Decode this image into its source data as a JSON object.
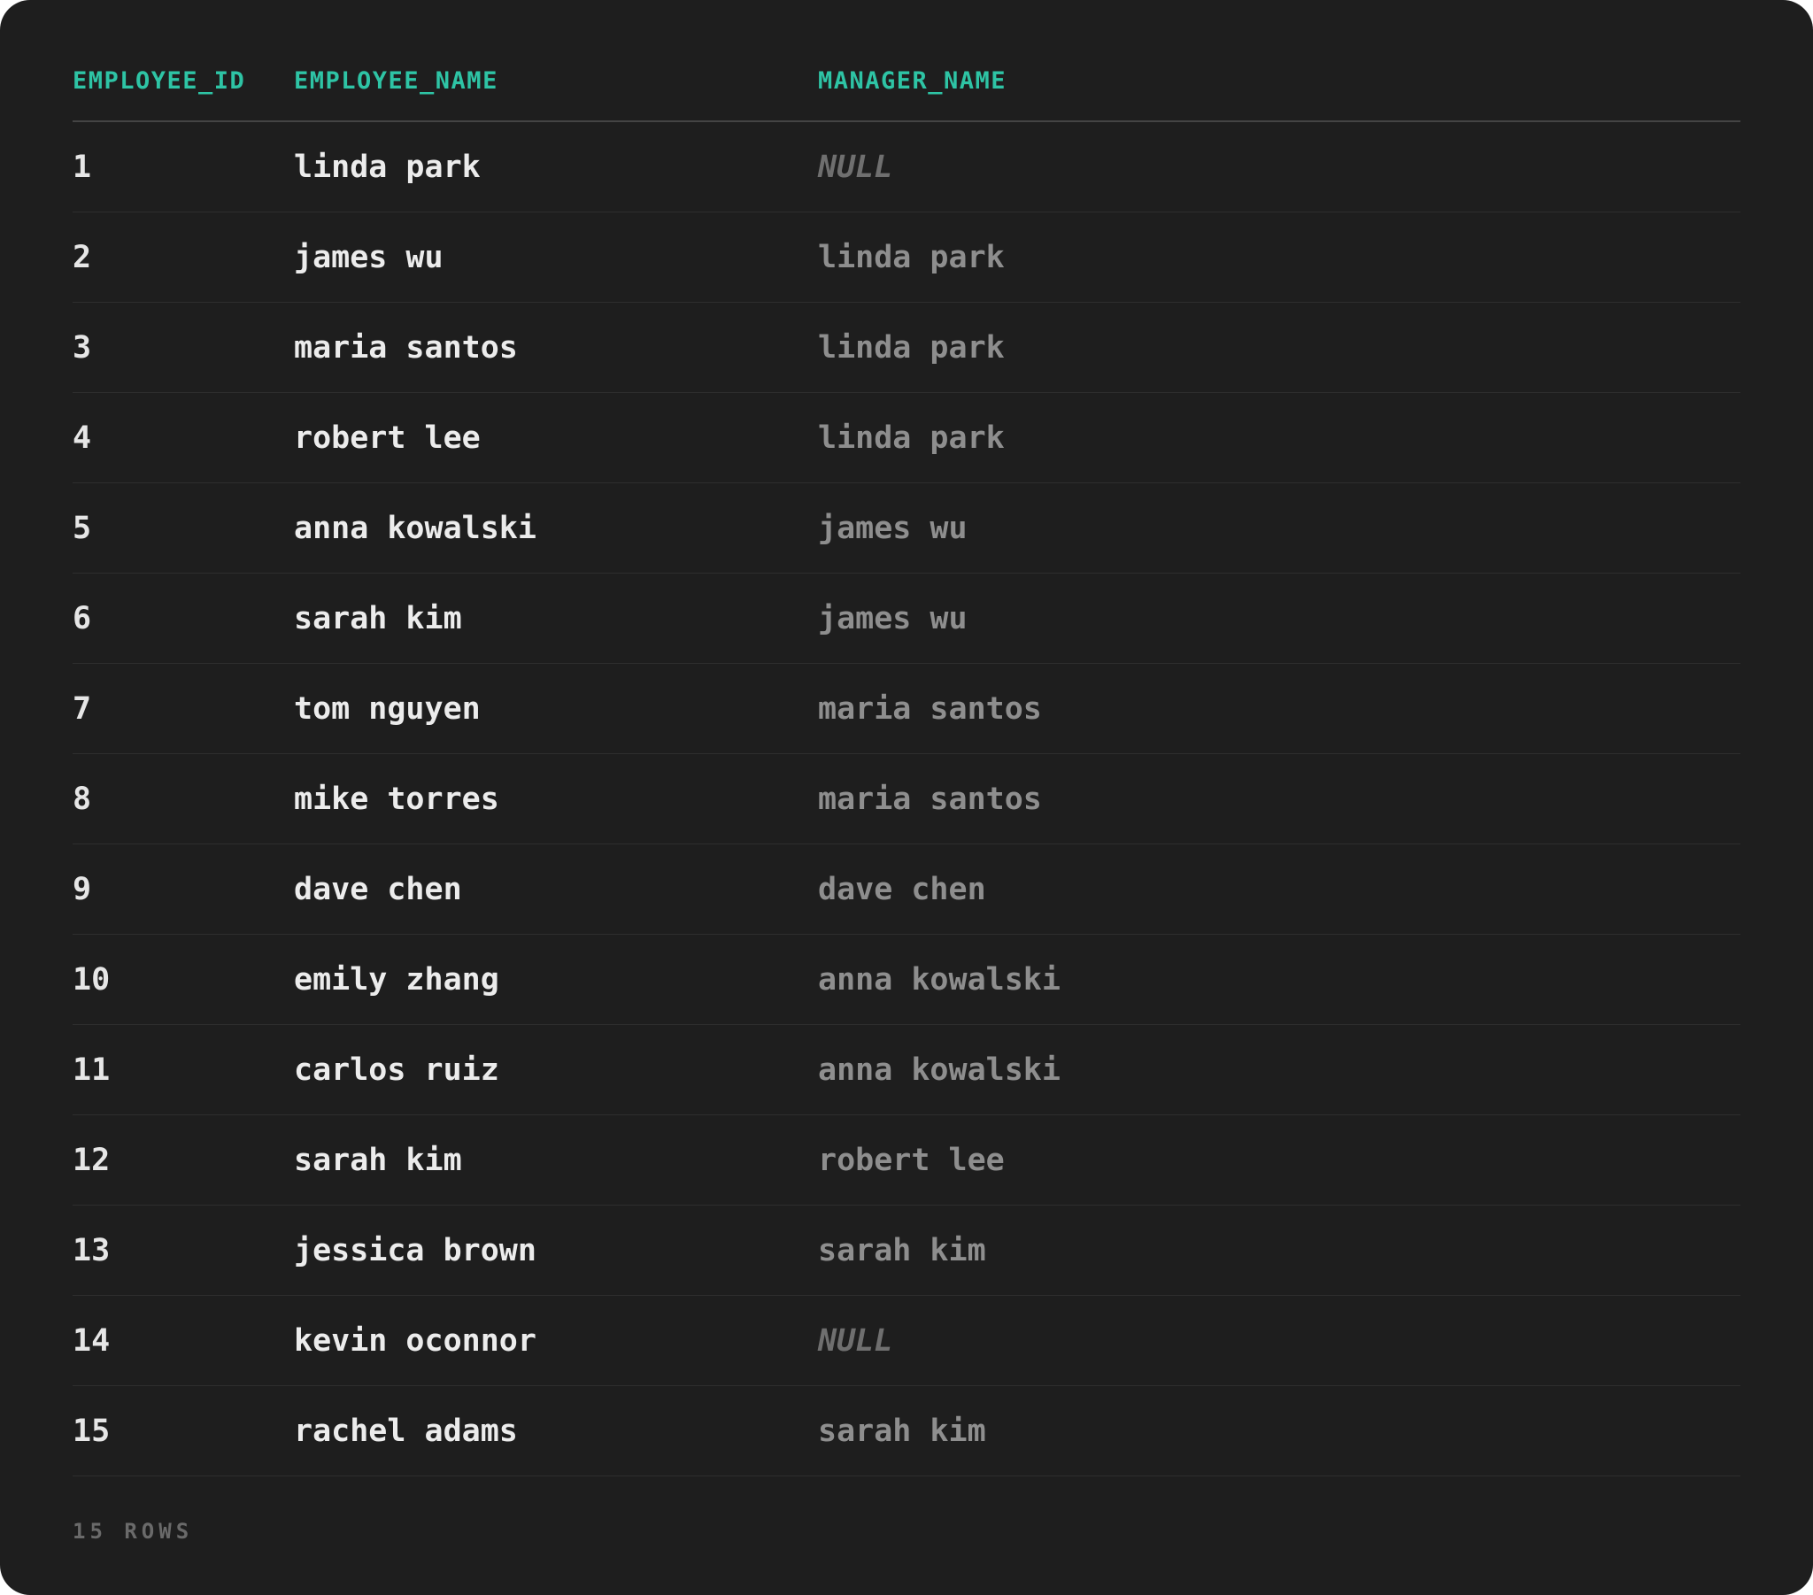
{
  "table": {
    "columns": [
      "EMPLOYEE_ID",
      "EMPLOYEE_NAME",
      "MANAGER_NAME"
    ],
    "rows": [
      {
        "employee_id": "1",
        "employee_name": "linda park",
        "manager_name": "NULL"
      },
      {
        "employee_id": "2",
        "employee_name": "james wu",
        "manager_name": "linda park"
      },
      {
        "employee_id": "3",
        "employee_name": "maria santos",
        "manager_name": "linda park"
      },
      {
        "employee_id": "4",
        "employee_name": "robert lee",
        "manager_name": "linda park"
      },
      {
        "employee_id": "5",
        "employee_name": "anna kowalski",
        "manager_name": "james wu"
      },
      {
        "employee_id": "6",
        "employee_name": "sarah kim",
        "manager_name": "james wu"
      },
      {
        "employee_id": "7",
        "employee_name": "tom nguyen",
        "manager_name": "maria santos"
      },
      {
        "employee_id": "8",
        "employee_name": "mike torres",
        "manager_name": "maria santos"
      },
      {
        "employee_id": "9",
        "employee_name": "dave chen",
        "manager_name": "dave chen"
      },
      {
        "employee_id": "10",
        "employee_name": "emily zhang",
        "manager_name": "anna kowalski"
      },
      {
        "employee_id": "11",
        "employee_name": "carlos ruiz",
        "manager_name": "anna kowalski"
      },
      {
        "employee_id": "12",
        "employee_name": "sarah kim",
        "manager_name": "robert lee"
      },
      {
        "employee_id": "13",
        "employee_name": "jessica brown",
        "manager_name": "sarah kim"
      },
      {
        "employee_id": "14",
        "employee_name": "kevin oconnor",
        "manager_name": "NULL"
      },
      {
        "employee_id": "15",
        "employee_name": "rachel adams",
        "manager_name": "sarah kim"
      }
    ]
  },
  "footer": {
    "row_count": "15 ROWS"
  },
  "colors": {
    "background": "#1e1e1e",
    "header_accent": "#2ec4a5",
    "primary_text": "#ececec",
    "secondary_text": "#8e8e8e",
    "null_text": "#6f6f6f"
  }
}
